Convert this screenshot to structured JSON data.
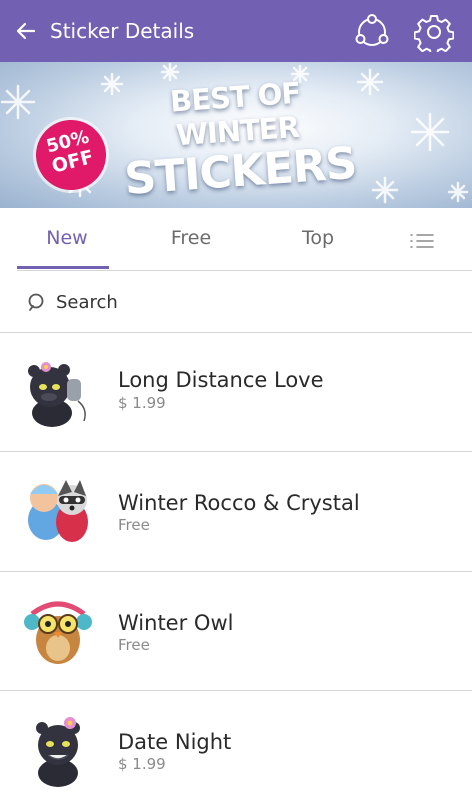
{
  "app_bar": {
    "title": "Sticker Details",
    "back_icon": "arrow-left-icon",
    "share_icon": "share-icon",
    "settings_icon": "gear-icon",
    "color": "#7260b3"
  },
  "banner": {
    "badge_line1": "50%",
    "badge_line2": "OFF",
    "title_line1": "BEST OF WINTER",
    "title_line2": "STICKERS",
    "badge_color": "#e01a68"
  },
  "tabs": {
    "items": [
      "New",
      "Free",
      "Top"
    ],
    "active": "New",
    "list_icon": "list-view-icon",
    "accent": "#7260b3"
  },
  "search": {
    "placeholder": "Search",
    "value": ""
  },
  "stickers": [
    {
      "name": "Long Distance Love",
      "price": "$ 1.99",
      "icon": "black-panther-phone-sticker"
    },
    {
      "name": "Winter Rocco & Crystal",
      "price": "Free",
      "icon": "raccoon-hug-sticker"
    },
    {
      "name": "Winter Owl",
      "price": "Free",
      "icon": "owl-earmuffs-sticker"
    },
    {
      "name": "Date Night",
      "price": "$ 1.99",
      "icon": "black-panther-flower-sticker"
    }
  ]
}
